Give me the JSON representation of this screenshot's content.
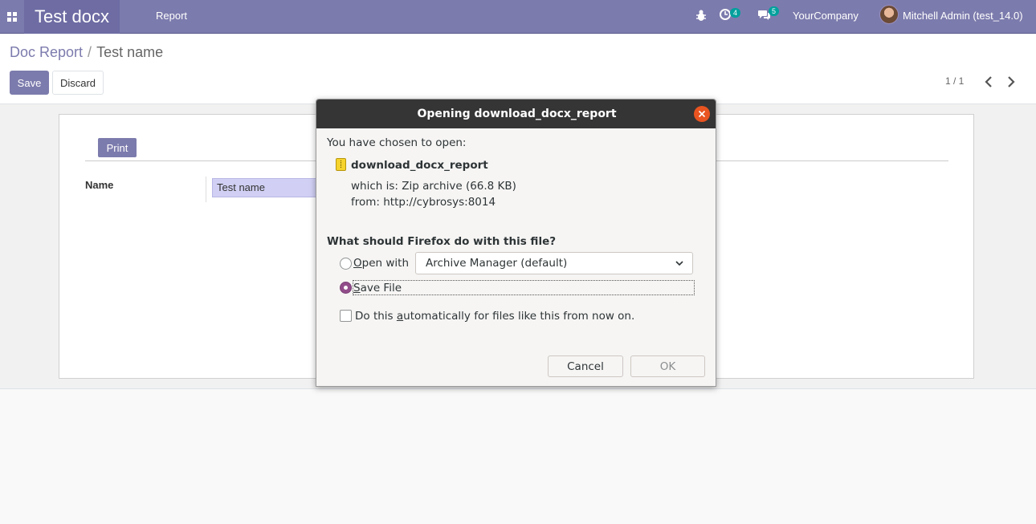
{
  "navbar": {
    "app_title": "Test docx",
    "menu_report": "Report",
    "activity_count": "4",
    "message_count": "5",
    "company": "YourCompany",
    "user": "Mitchell Admin (test_14.0)",
    "icons": [
      "apps-grid-icon",
      "bug-icon",
      "activity-clock-icon",
      "chat-bubbles-icon"
    ]
  },
  "control_panel": {
    "breadcrumb_parent": "Doc Report",
    "breadcrumb_separator": "/",
    "breadcrumb_current": "Test name",
    "save_label": "Save",
    "discard_label": "Discard",
    "pager": "1 / 1"
  },
  "form": {
    "print_label": "Print",
    "name_label": "Name",
    "name_value": "Test name"
  },
  "dialog": {
    "title": "Opening download_docx_report",
    "chosen_text": "You have chosen to open:",
    "filename": "download_docx_report",
    "which_is": "which is: Zip archive (66.8 KB)",
    "from": "from: http://cybrosys:8014",
    "question": "What should Firefox do with this file?",
    "open_with_first": "O",
    "open_with_rest": "pen with",
    "open_with_app": "Archive Manager (default)",
    "save_first": "S",
    "save_rest": "ave File",
    "auto_pre": "Do this ",
    "auto_key": "a",
    "auto_post": "utomatically for files like this from now on.",
    "cancel_label": "Cancel",
    "ok_label": "OK",
    "selected_option": "Save File",
    "auto_checked": false
  },
  "colors": {
    "navbar": "#7c7bad",
    "primary_button": "#7c7bad",
    "dialog_titlebar": "#353535",
    "close_button": "#e95420",
    "radio_selected": "#924d8b"
  }
}
